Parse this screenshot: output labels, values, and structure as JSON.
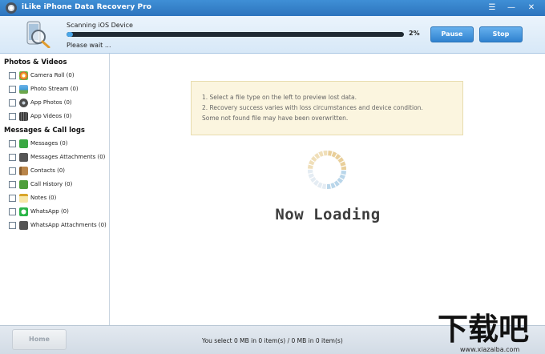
{
  "window": {
    "title": "iLike iPhone Data Recovery Pro",
    "controls": {
      "menu": "☰",
      "minimize": "—",
      "close": "✕"
    }
  },
  "scan": {
    "title": "Scanning iOS Device",
    "status": "Please wait ...",
    "progress_percent": 2,
    "progress_label": "2%",
    "pause_label": "Pause",
    "stop_label": "Stop"
  },
  "sidebar": {
    "categories": [
      {
        "name": "Photos & Videos",
        "items": [
          {
            "label": "Camera Roll (0)",
            "icon": "camera-roll-icon",
            "color": "#f2a227"
          },
          {
            "label": "Photo Stream (0)",
            "icon": "photo-stream-icon",
            "color": "#3a9ad9"
          },
          {
            "label": "App Photos (0)",
            "icon": "app-photos-icon",
            "color": "#4d4d4d"
          },
          {
            "label": "App Videos (0)",
            "icon": "app-videos-icon",
            "color": "#3b3b3b"
          }
        ]
      },
      {
        "name": "Messages & Call logs",
        "items": [
          {
            "label": "Messages (0)",
            "icon": "messages-icon",
            "color": "#3aa843"
          },
          {
            "label": "Messages Attachments (0)",
            "icon": "attachment-icon",
            "color": "#555555"
          },
          {
            "label": "Contacts (0)",
            "icon": "contacts-icon",
            "color": "#b9854a"
          },
          {
            "label": "Call History (0)",
            "icon": "call-history-icon",
            "color": "#4e9e3a"
          },
          {
            "label": "Notes (0)",
            "icon": "notes-icon",
            "color": "#f0c64a"
          },
          {
            "label": "WhatsApp (0)",
            "icon": "whatsapp-icon",
            "color": "#2bb548"
          },
          {
            "label": "WhatsApp Attachments (0)",
            "icon": "whatsapp-attachment-icon",
            "color": "#555555"
          }
        ]
      }
    ]
  },
  "main": {
    "info_lines": [
      "1. Select a file type on the left to preview lost data.",
      "2. Recovery success varies with loss circumstances and device condition.",
      "Some not found file may have been overwritten."
    ],
    "loading_text": "Now Loading"
  },
  "footer": {
    "home_label": "Home",
    "status": "You select 0 MB in 0 item(s) / 0 MB in 0 item(s)"
  },
  "watermark": {
    "text": "下载吧",
    "url": "www.xiazaiba.com"
  }
}
